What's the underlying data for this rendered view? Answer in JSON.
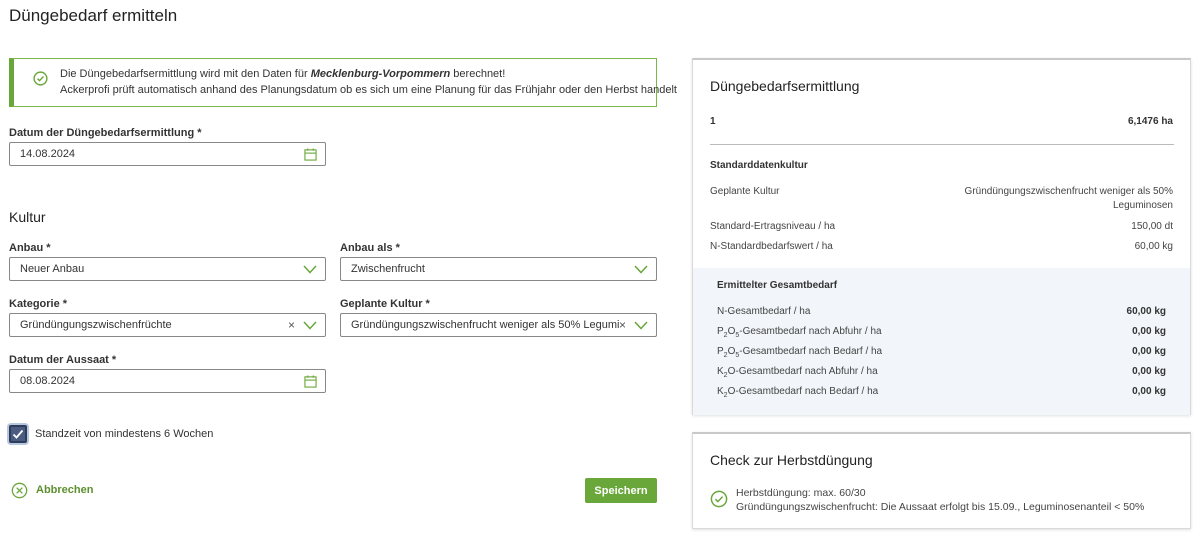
{
  "page_title": "Düngebedarf ermitteln",
  "alert": {
    "line1_pre": "Die Düngebedarfsermittlung wird mit den Daten für ",
    "line1_bold": "Mecklenburg-Vorpommern",
    "line1_post": " berechnet!",
    "line2": "Ackerprofi prüft automatisch anhand des Planungsdatum ob es sich um eine Planung für das Frühjahr oder den Herbst handelt"
  },
  "date_field": {
    "label": "Datum der Düngebedarfsermittlung *",
    "value": "14.08.2024"
  },
  "kultur": {
    "heading": "Kultur",
    "anbau": {
      "label": "Anbau *",
      "value": "Neuer Anbau"
    },
    "anbau_als": {
      "label": "Anbau als *",
      "value": "Zwischenfrucht"
    },
    "kategorie": {
      "label": "Kategorie *",
      "value": "Gründüngungszwischenfrüchte"
    },
    "geplante_kultur": {
      "label": "Geplante Kultur *",
      "value": "Gründüngungszwischenfrucht weniger als 50% Legumi..."
    },
    "aussaat": {
      "label": "Datum der Aussaat *",
      "value": "08.08.2024"
    }
  },
  "checkbox": {
    "label": "Standzeit von mindestens 6 Wochen",
    "checked": true
  },
  "actions": {
    "cancel": "Abbrechen",
    "save": "Speichern"
  },
  "summary": {
    "title": "Düngebedarfsermittlung",
    "field_id": "1",
    "field_area": "6,1476 ha",
    "std_heading": "Standarddatenkultur",
    "rows": [
      {
        "label": "Geplante Kultur",
        "value_line1": "Gründüngungszwischenfrucht weniger als 50%",
        "value_line2": "Leguminosen"
      },
      {
        "label": "Standard-Ertragsniveau / ha",
        "value": "150,00 dt"
      },
      {
        "label": "N-Standardbedarfswert / ha",
        "value": "60,00 kg"
      }
    ],
    "total_heading": "Ermittelter Gesamtbedarf",
    "totals": [
      {
        "pre": "N-Gesamtbedarf / ha",
        "value": "60,00 kg"
      },
      {
        "pre": "P",
        "sub1": "2",
        "mid": "O",
        "sub2": "5",
        "post": "-Gesamtbedarf nach Abfuhr / ha",
        "value": "0,00 kg"
      },
      {
        "pre": "P",
        "sub1": "2",
        "mid": "O",
        "sub2": "5",
        "post": "-Gesamtbedarf nach Bedarf / ha",
        "value": "0,00 kg"
      },
      {
        "pre": "K",
        "sub1": "2",
        "mid": "O",
        "post": "-Gesamtbedarf nach Abfuhr / ha",
        "value": "0,00 kg"
      },
      {
        "pre": "K",
        "sub1": "2",
        "mid": "O",
        "post": "-Gesamtbedarf nach Bedarf / ha",
        "value": "0,00 kg"
      }
    ]
  },
  "herbst": {
    "title": "Check zur Herbstdüngung",
    "line1": "Herbstdüngung: max. 60/30",
    "line2": "Gründüngungszwischenfrucht: Die Aussaat erfolgt bis 15.09., Leguminosenanteil < 50%"
  },
  "colors": {
    "accent": "#6aa73a",
    "accent_dark": "#5d8f2e",
    "checkbox": "#4a5c80",
    "panel": "#f2f6fa"
  },
  "icons": [
    "check-circle-icon",
    "calendar-icon",
    "chevron-down-icon",
    "clear-x-icon",
    "cancel-circle-icon",
    "checkmark-icon"
  ]
}
